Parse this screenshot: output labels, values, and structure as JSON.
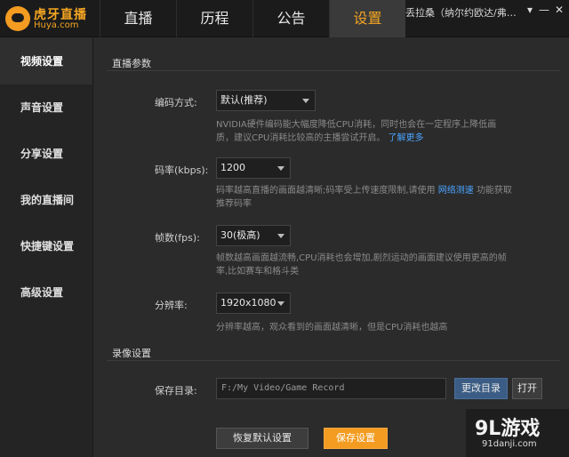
{
  "app": {
    "logo_cn": "虎牙直播",
    "logo_en": "Huya.com"
  },
  "tabs": [
    {
      "label": "直播"
    },
    {
      "label": "历程"
    },
    {
      "label": "公告"
    },
    {
      "label": "设置"
    }
  ],
  "user": {
    "name": "丢拉桑（纳尔约欧达/弗…"
  },
  "window_controls": {
    "menu": "▾",
    "minimize": "—",
    "close": "✕"
  },
  "sidebar": {
    "items": [
      {
        "label": "视频设置"
      },
      {
        "label": "声音设置"
      },
      {
        "label": "分享设置"
      },
      {
        "label": "我的直播间"
      },
      {
        "label": "快捷键设置"
      },
      {
        "label": "高级设置"
      }
    ]
  },
  "live_settings": {
    "title": "直播参数",
    "encoding": {
      "label": "编码方式:",
      "value": "默认(推荐)",
      "hint": "NVIDIA硬件编码能大幅度降低CPU消耗，同时也会在一定程序上降低画质，建议CPU消耗比较高的主播尝试开启。",
      "link": "了解更多"
    },
    "bitrate": {
      "label": "码率(kbps):",
      "value": "1200",
      "hint_before": "码率越高直播的画面越清晰;码率受上传速度限制,请使用",
      "link": "网络测速",
      "hint_after": "功能获取推荐码率"
    },
    "fps": {
      "label": "帧数(fps):",
      "value": "30(极高)",
      "hint": "帧数越高画面越流畅,CPU消耗也会增加,剧烈运动的画面建议使用更高的帧率,比如赛车和格斗类"
    },
    "resolution": {
      "label": "分辨率:",
      "value": "1920x1080",
      "hint": "分辨率越高，观众看到的画面越清晰，但是CPU消耗也越高"
    }
  },
  "record_settings": {
    "title": "录像设置",
    "dir_label": "保存目录:",
    "dir_value": "F:/My Video/Game Record",
    "change_dir": "更改目录",
    "open": "打开"
  },
  "footer": {
    "reset": "恢复默认设置",
    "save": "保存设置"
  },
  "watermark": {
    "big": "9L游戏",
    "small": "91danji.com"
  }
}
